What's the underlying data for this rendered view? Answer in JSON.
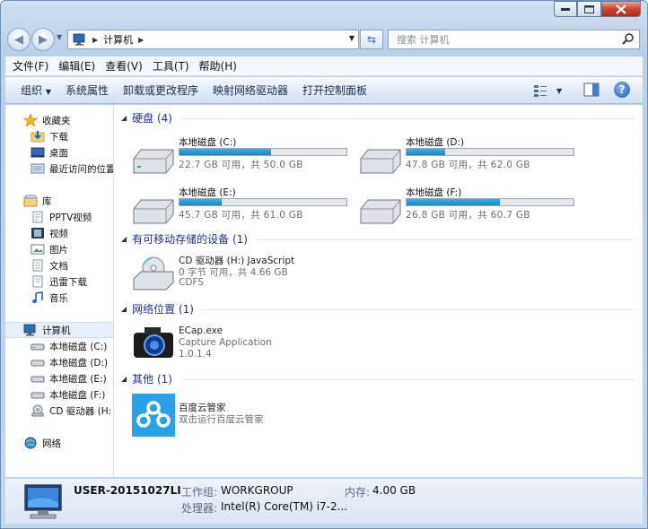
{
  "window": {
    "caption_buttons": {
      "minimize": "minimize-icon",
      "maximize": "maximize-icon",
      "close": "close-icon"
    }
  },
  "address": {
    "crumb": "计算机",
    "search_placeholder": "搜索 计算机"
  },
  "menu": [
    "文件(F)",
    "编辑(E)",
    "查看(V)",
    "工具(T)",
    "帮助(H)"
  ],
  "commands": [
    "组织",
    "系统属性",
    "卸载或更改程序",
    "映射网络驱动器",
    "打开控制面板"
  ],
  "nav": {
    "favorites": {
      "label": "收藏夹",
      "items": [
        "下载",
        "桌面",
        "最近访问的位置"
      ]
    },
    "libraries": {
      "label": "库",
      "items": [
        "PPTV视频",
        "视频",
        "图片",
        "文档",
        "迅雷下载",
        "音乐"
      ]
    },
    "computer": {
      "label": "计算机",
      "items": [
        "本地磁盘 (C:)",
        "本地磁盘 (D:)",
        "本地磁盘 (E:)",
        "本地磁盘 (F:)",
        "CD 驱动器 (H:"
      ]
    },
    "network": {
      "label": "网络"
    }
  },
  "groups": {
    "hard_disks": {
      "title": "硬盘 (4)"
    },
    "removable": {
      "title": "有可移动存储的设备 (1)"
    },
    "network": {
      "title": "网络位置 (1)"
    },
    "other": {
      "title": "其他 (1)"
    }
  },
  "drives": [
    {
      "name": "本地磁盘 (C:)",
      "free_text": "22.7 GB 可用，共 50.0 GB",
      "used_fraction": 0.546
    },
    {
      "name": "本地磁盘 (D:)",
      "free_text": "47.8 GB 可用，共 62.0 GB",
      "used_fraction": 0.229
    },
    {
      "name": "本地磁盘 (E:)",
      "free_text": "45.7 GB 可用，共 61.0 GB",
      "used_fraction": 0.251
    },
    {
      "name": "本地磁盘 (F:)",
      "free_text": "26.8 GB 可用，共 60.7 GB",
      "used_fraction": 0.558
    }
  ],
  "cd": {
    "name": "CD 驱动器 (H:) JavaScript",
    "free": "0 字节 可用，共 4.66 GB",
    "fs": "CDFS"
  },
  "network_item": {
    "name": "ECap.exe",
    "desc": "Capture Application",
    "version": "1.0.1.4"
  },
  "other_item": {
    "name": "百度云管家",
    "desc": "双击运行百度云管家"
  },
  "details": {
    "computer_name": "USER-20151027LI",
    "workgroup_label": "工作组:",
    "workgroup": "WORKGROUP",
    "memory_label": "内存:",
    "memory": "4.00 GB",
    "cpu_label": "处理器:",
    "cpu": "Intel(R) Core(TM) i7-2..."
  },
  "colors": {
    "bar_fill": "#2a9bd8",
    "group_header": "#1e3287"
  }
}
